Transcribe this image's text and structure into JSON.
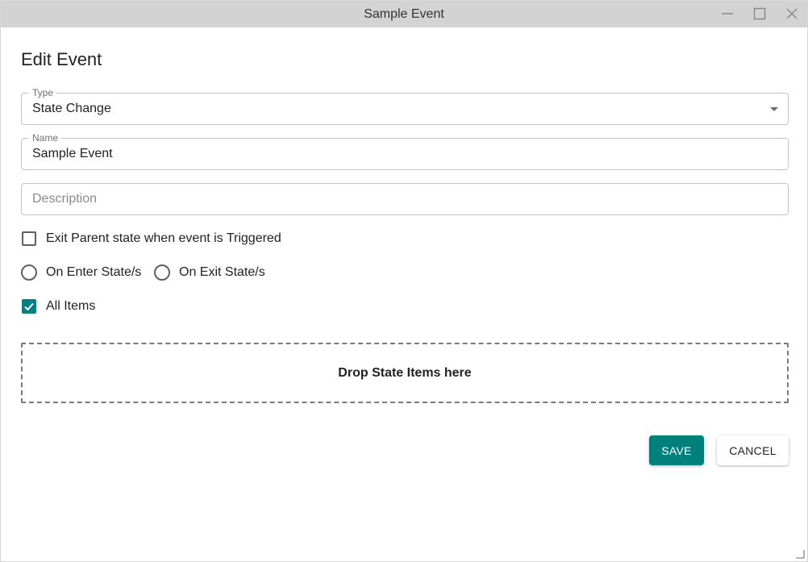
{
  "window": {
    "title": "Sample Event"
  },
  "form": {
    "heading": "Edit Event",
    "type": {
      "label": "Type",
      "value": "State Change"
    },
    "name": {
      "label": "Name",
      "value": "Sample Event"
    },
    "description": {
      "placeholder": "Description",
      "value": ""
    },
    "exit_parent": {
      "label": "Exit Parent state when event is Triggered",
      "checked": false
    },
    "radio_options": [
      {
        "label": "On Enter State/s",
        "selected": false
      },
      {
        "label": "On Exit State/s",
        "selected": false
      }
    ],
    "all_items": {
      "label": "All Items",
      "checked": true
    },
    "dropzone_text": "Drop State Items here"
  },
  "actions": {
    "save_label": "SAVE",
    "cancel_label": "CANCEL"
  },
  "colors": {
    "accent": "#00807a",
    "titlebar": "#d3d3d3"
  }
}
